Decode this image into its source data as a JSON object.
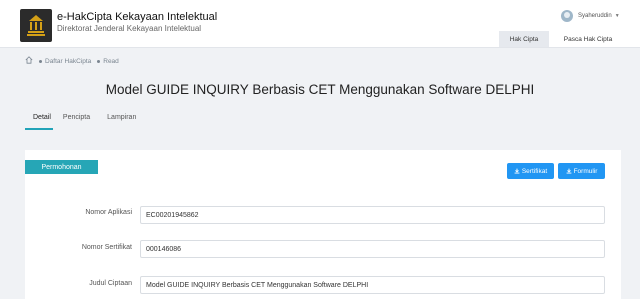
{
  "header": {
    "app_title": "e-HakCipta Kekayaan Intelektual",
    "app_subtitle": "Direktorat Jenderal Kekayaan Intelektual",
    "user_name": "Syaheruddin",
    "nav": {
      "hak_cipta": "Hak Cipta",
      "pasca_hak_cipta": "Pasca Hak Cipta"
    }
  },
  "breadcrumb": [
    "Daftar HakCipta",
    "Read"
  ],
  "page_title": "Model GUIDE INQUIRY Berbasis CET Menggunakan Software DELPHI",
  "tabs": [
    "Detail",
    "Pencipta",
    "Lampiran"
  ],
  "section": {
    "label": "Permohonan",
    "buttons": {
      "sertifikat": "Sertifikat",
      "formulir": "Formulir"
    },
    "fields": [
      {
        "label": "Nomor Aplikasi",
        "value": "EC00201945862"
      },
      {
        "label": "Nomor Sertifikat",
        "value": "000146086"
      },
      {
        "label": "Judul Ciptaan",
        "value": "Model GUIDE INQUIRY Berbasis CET Menggunakan Software DELPHI"
      }
    ]
  },
  "colors": {
    "accent": "#26a6b6",
    "button": "#2196f3",
    "tab_underline": "#21a3b8"
  }
}
